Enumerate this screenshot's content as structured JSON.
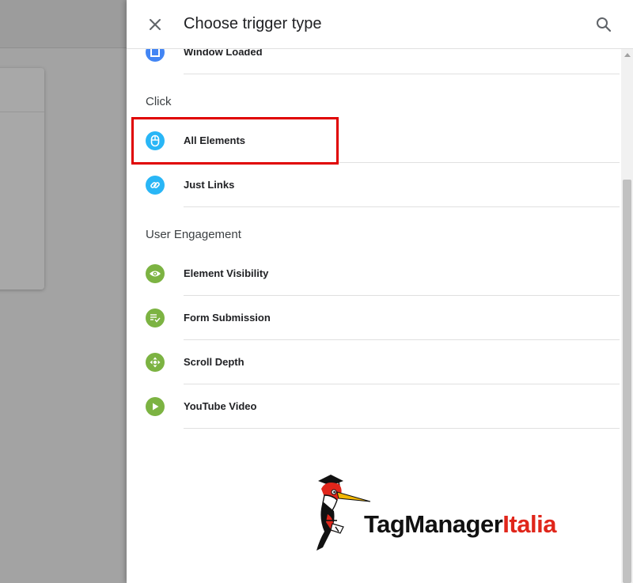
{
  "panel": {
    "title": "Choose trigger type"
  },
  "top_item": {
    "label": "Window Loaded",
    "icon": "window-icon"
  },
  "sections": [
    {
      "title": "Click",
      "items": [
        {
          "label": "All Elements",
          "icon": "mouse-icon",
          "color": "#29b6f6",
          "highlighted": true
        },
        {
          "label": "Just Links",
          "icon": "link-icon",
          "color": "#29b6f6"
        }
      ]
    },
    {
      "title": "User Engagement",
      "items": [
        {
          "label": "Element Visibility",
          "icon": "eye-icon",
          "color": "#7cb342"
        },
        {
          "label": "Form Submission",
          "icon": "form-check-icon",
          "color": "#7cb342"
        },
        {
          "label": "Scroll Depth",
          "icon": "scroll-arrows-icon",
          "color": "#7cb342"
        },
        {
          "label": "YouTube Video",
          "icon": "play-icon",
          "color": "#7cb342"
        }
      ]
    }
  ],
  "logo": {
    "part1": "TagManager",
    "part2": "Italia",
    "color_dark": "#111111",
    "color_red": "#e0261b"
  },
  "colors": {
    "highlight": "#e00000",
    "blue": "#4285f4",
    "light_blue": "#29b6f6",
    "green": "#7cb342"
  }
}
